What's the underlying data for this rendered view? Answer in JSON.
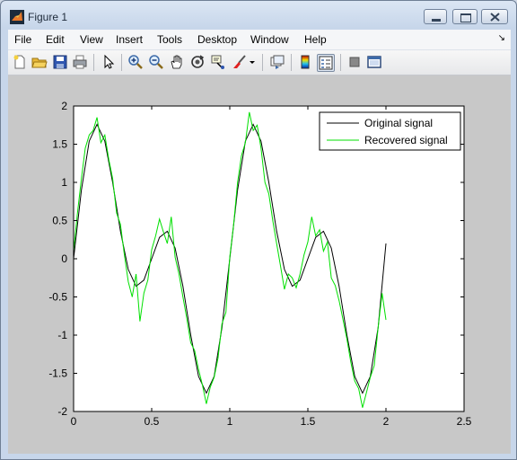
{
  "window": {
    "title": "Figure 1"
  },
  "menu": [
    "File",
    "Edit",
    "View",
    "Insert",
    "Tools",
    "Desktop",
    "Window",
    "Help"
  ],
  "toolbar_icons": [
    "new-figure-icon",
    "open-file-icon",
    "save-icon",
    "print-icon",
    "edit-plot-icon",
    "zoom-in-icon",
    "zoom-out-icon",
    "pan-icon",
    "rotate-3d-icon",
    "data-cursor-icon",
    "brush-icon",
    "brush-dropdown-icon",
    "link-plot-icon",
    "insert-colorbar-icon",
    "insert-legend-icon",
    "hide-plot-tools-icon",
    "show-plot-tools-icon"
  ],
  "chart_data": {
    "type": "line",
    "xlim": [
      0,
      2.5
    ],
    "ylim": [
      -2,
      2
    ],
    "xticks": [
      "0",
      "0.5",
      "1",
      "1.5",
      "2",
      "2.5"
    ],
    "yticks": [
      "-2",
      "-1.5",
      "-1",
      "-0.5",
      "0",
      "0.5",
      "1",
      "1.5",
      "2"
    ],
    "grid": false,
    "legend_position": "top-right",
    "legend": [
      "Original signal",
      "Recovered signal"
    ],
    "series": [
      {
        "name": "Original signal",
        "color": "#000000",
        "function": "sin(2*pi*t) + sin(4*pi*t)",
        "x_range": [
          0,
          2
        ],
        "x": [
          0,
          0.05,
          0.1,
          0.15,
          0.2,
          0.25,
          0.3,
          0.35,
          0.4,
          0.45,
          0.5,
          0.55,
          0.6,
          0.65,
          0.7,
          0.75,
          0.8,
          0.85,
          0.9,
          0.95,
          1.0,
          1.05,
          1.1,
          1.15,
          1.2,
          1.25,
          1.3,
          1.35,
          1.4,
          1.45,
          1.5,
          1.55,
          1.6,
          1.65,
          1.7,
          1.75,
          1.8,
          1.85,
          1.9,
          1.95,
          2.0
        ],
        "y": [
          0,
          0.9,
          1.54,
          1.76,
          1.54,
          1.0,
          0.36,
          -0.14,
          -0.36,
          -0.28,
          0,
          0.28,
          0.36,
          0.14,
          -0.36,
          -1.0,
          -1.54,
          -1.76,
          -1.54,
          -0.9,
          0,
          0.9,
          1.54,
          1.76,
          1.54,
          1.0,
          0.36,
          -0.14,
          -0.36,
          -0.28,
          0,
          0.28,
          0.36,
          0.14,
          -0.36,
          -1.0,
          -1.54,
          -1.76,
          -1.54,
          -0.9,
          0.2
        ]
      },
      {
        "name": "Recovered signal",
        "color": "#00e000",
        "x": [
          0,
          0.025,
          0.05,
          0.075,
          0.1,
          0.125,
          0.15,
          0.175,
          0.2,
          0.225,
          0.25,
          0.275,
          0.3,
          0.325,
          0.35,
          0.375,
          0.4,
          0.425,
          0.45,
          0.475,
          0.5,
          0.525,
          0.55,
          0.575,
          0.6,
          0.625,
          0.65,
          0.675,
          0.7,
          0.725,
          0.75,
          0.775,
          0.8,
          0.825,
          0.85,
          0.875,
          0.9,
          0.925,
          0.95,
          0.975,
          1.0,
          1.025,
          1.05,
          1.075,
          1.1,
          1.125,
          1.15,
          1.175,
          1.2,
          1.225,
          1.25,
          1.275,
          1.3,
          1.325,
          1.35,
          1.375,
          1.4,
          1.425,
          1.45,
          1.475,
          1.5,
          1.525,
          1.55,
          1.575,
          1.6,
          1.625,
          1.65,
          1.675,
          1.7,
          1.725,
          1.75,
          1.775,
          1.8,
          1.825,
          1.85,
          1.875,
          1.9,
          1.925,
          1.95,
          1.975,
          2.0
        ],
        "y": [
          0.1,
          0.6,
          1.05,
          1.45,
          1.62,
          1.68,
          1.85,
          1.52,
          1.62,
          1.3,
          1.05,
          0.6,
          0.45,
          0.05,
          -0.3,
          -0.5,
          -0.2,
          -0.82,
          -0.45,
          -0.28,
          0.12,
          0.3,
          0.52,
          0.35,
          0.2,
          0.55,
          0.02,
          -0.2,
          -0.5,
          -0.78,
          -1.1,
          -1.2,
          -1.45,
          -1.65,
          -1.9,
          -1.68,
          -1.55,
          -1.3,
          -0.85,
          -0.7,
          0.02,
          0.45,
          1.0,
          1.35,
          1.52,
          1.92,
          1.68,
          1.75,
          1.45,
          1.0,
          0.85,
          0.5,
          0.2,
          -0.1,
          -0.4,
          -0.2,
          -0.25,
          -0.38,
          -0.2,
          0.05,
          0.22,
          0.55,
          0.3,
          0.38,
          0.1,
          0.22,
          -0.25,
          -0.35,
          -0.55,
          -0.8,
          -1.05,
          -1.35,
          -1.6,
          -1.7,
          -1.95,
          -1.75,
          -1.55,
          -1.4,
          -0.9,
          -0.45,
          -0.8
        ]
      }
    ]
  }
}
